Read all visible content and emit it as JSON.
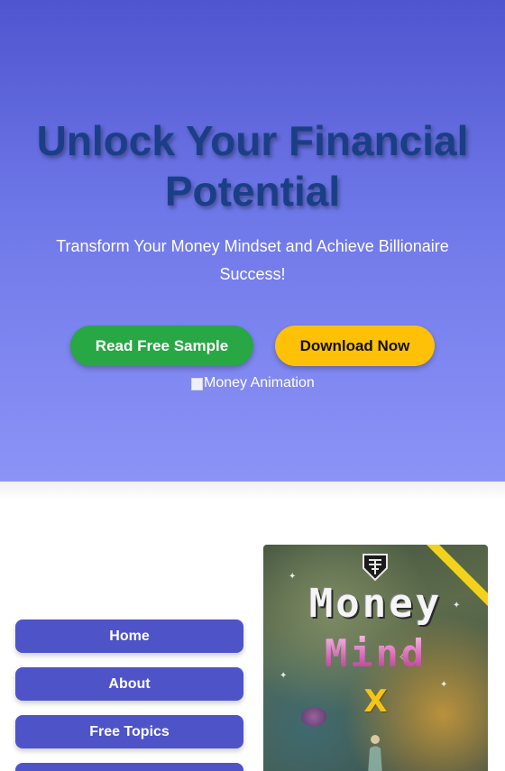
{
  "hero": {
    "title": "Unlock Your Financial Potential",
    "subtitle": "Transform Your Money Mindset and Achieve Billionaire Success!",
    "buttons": {
      "sample": "Read Free Sample",
      "download": "Download Now"
    },
    "image_alt": "Money Animation"
  },
  "nav": {
    "items": [
      {
        "label": "Home"
      },
      {
        "label": "About"
      },
      {
        "label": "Free Topics"
      }
    ]
  },
  "cover": {
    "title_line1": "Money",
    "title_line2": "Mind",
    "title_line3": "X"
  },
  "colors": {
    "hero_top": "#4f55cf",
    "hero_bottom": "#8c93f7",
    "title": "#1a3f86",
    "sample_button": "#28a745",
    "download_button": "#ffc107",
    "nav_button": "#4e54c8"
  },
  "icons": [
    "broken-image-icon",
    "cover-logo-icon"
  ]
}
